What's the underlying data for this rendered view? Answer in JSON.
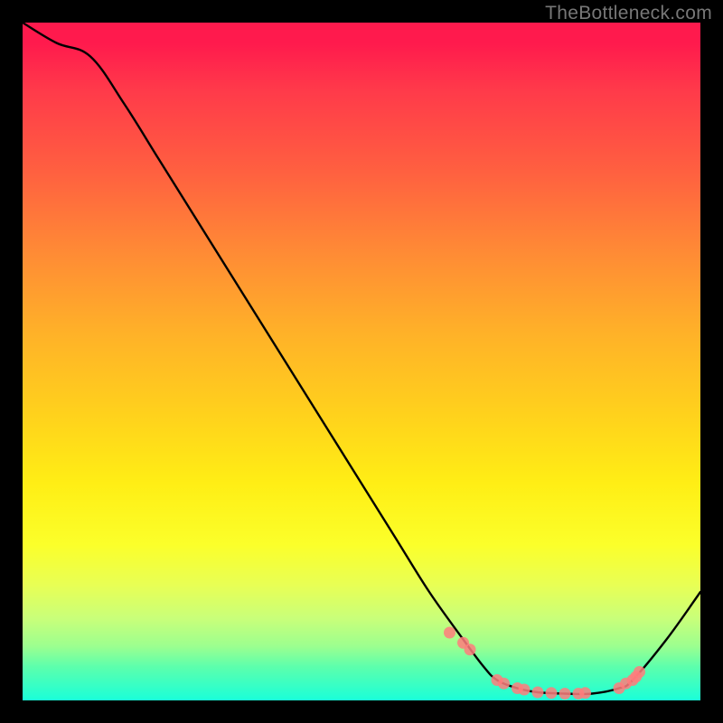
{
  "watermark": "TheBottleneck.com",
  "chart_data": {
    "type": "line",
    "title": "",
    "xlabel": "",
    "ylabel": "",
    "xlim": [
      0,
      100
    ],
    "ylim": [
      0,
      100
    ],
    "series": [
      {
        "name": "bottleneck-curve",
        "x": [
          0,
          5,
          10,
          15,
          20,
          25,
          30,
          35,
          40,
          45,
          50,
          55,
          60,
          65,
          68,
          70,
          73,
          76,
          80,
          84,
          88,
          90,
          95,
          100
        ],
        "values": [
          100,
          97,
          95,
          88,
          80,
          72,
          64,
          56,
          48,
          40,
          32,
          24,
          16,
          9,
          5,
          3,
          1.8,
          1.2,
          1,
          1,
          1.8,
          3,
          9,
          16
        ]
      }
    ],
    "markers": {
      "name": "highlighted-points",
      "color": "#ff7d7d",
      "points": [
        {
          "x": 63,
          "y": 10
        },
        {
          "x": 65,
          "y": 8.5
        },
        {
          "x": 66,
          "y": 7.5
        },
        {
          "x": 70,
          "y": 3
        },
        {
          "x": 71,
          "y": 2.5
        },
        {
          "x": 73,
          "y": 1.8
        },
        {
          "x": 74,
          "y": 1.6
        },
        {
          "x": 76,
          "y": 1.2
        },
        {
          "x": 78,
          "y": 1.1
        },
        {
          "x": 80,
          "y": 1.0
        },
        {
          "x": 82,
          "y": 1.0
        },
        {
          "x": 83,
          "y": 1.1
        },
        {
          "x": 88,
          "y": 1.8
        },
        {
          "x": 89,
          "y": 2.5
        },
        {
          "x": 90,
          "y": 3.0
        },
        {
          "x": 90.5,
          "y": 3.5
        },
        {
          "x": 91,
          "y": 4.2
        }
      ]
    }
  }
}
